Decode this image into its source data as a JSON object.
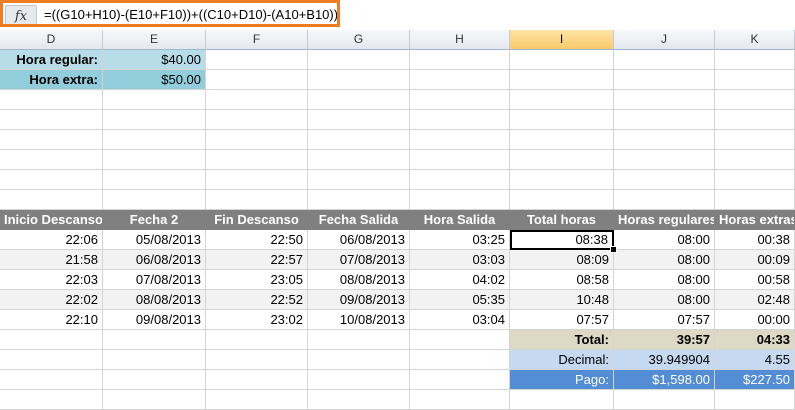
{
  "formula_bar": {
    "fx_label": "fx",
    "formula": "=((G10+H10)-(E10+F10))+((C10+D10)-(A10+B10))",
    "highlight_color": "#f07d22"
  },
  "columns": [
    "D",
    "E",
    "F",
    "G",
    "H",
    "I",
    "J",
    "K"
  ],
  "rates": [
    {
      "label": "Hora regular:",
      "value": "$40.00"
    },
    {
      "label": "Hora extra:",
      "value": "$50.00"
    }
  ],
  "table": {
    "headers": [
      "Inicio Descanso",
      "Fecha 2",
      "Fin Descanso",
      "Fecha Salida",
      "Hora Salida",
      "Total horas",
      "Horas regulares",
      "Horas extras"
    ],
    "rows": [
      [
        "22:06",
        "05/08/2013",
        "22:50",
        "06/08/2013",
        "03:25",
        "08:38",
        "08:00",
        "00:38"
      ],
      [
        "21:58",
        "06/08/2013",
        "22:57",
        "07/08/2013",
        "03:03",
        "08:09",
        "08:00",
        "00:09"
      ],
      [
        "22:03",
        "07/08/2013",
        "23:05",
        "08/08/2013",
        "04:02",
        "08:58",
        "08:00",
        "00:58"
      ],
      [
        "22:02",
        "08/08/2013",
        "22:52",
        "09/08/2013",
        "05:35",
        "10:48",
        "08:00",
        "02:48"
      ],
      [
        "22:10",
        "09/08/2013",
        "23:02",
        "10/08/2013",
        "03:04",
        "07:57",
        "07:57",
        "00:00"
      ]
    ]
  },
  "summary": {
    "total": {
      "label": "Total:",
      "regular": "39:57",
      "extra": "04:33"
    },
    "decimal": {
      "label": "Decimal:",
      "regular": "39.949904",
      "extra": "4.55"
    },
    "pay": {
      "label": "Pago:",
      "regular": "$1,598.00",
      "extra": "$227.50"
    }
  },
  "colors": {
    "header_gray": "#808080",
    "rate_label_light": "#b7dde8",
    "rate_label_dark": "#92cddc",
    "total_tan": "#ddd9c4",
    "decimal_blue": "#c5d9f1",
    "pay_blue": "#538dd5",
    "selected_column": "#f9c96a"
  }
}
